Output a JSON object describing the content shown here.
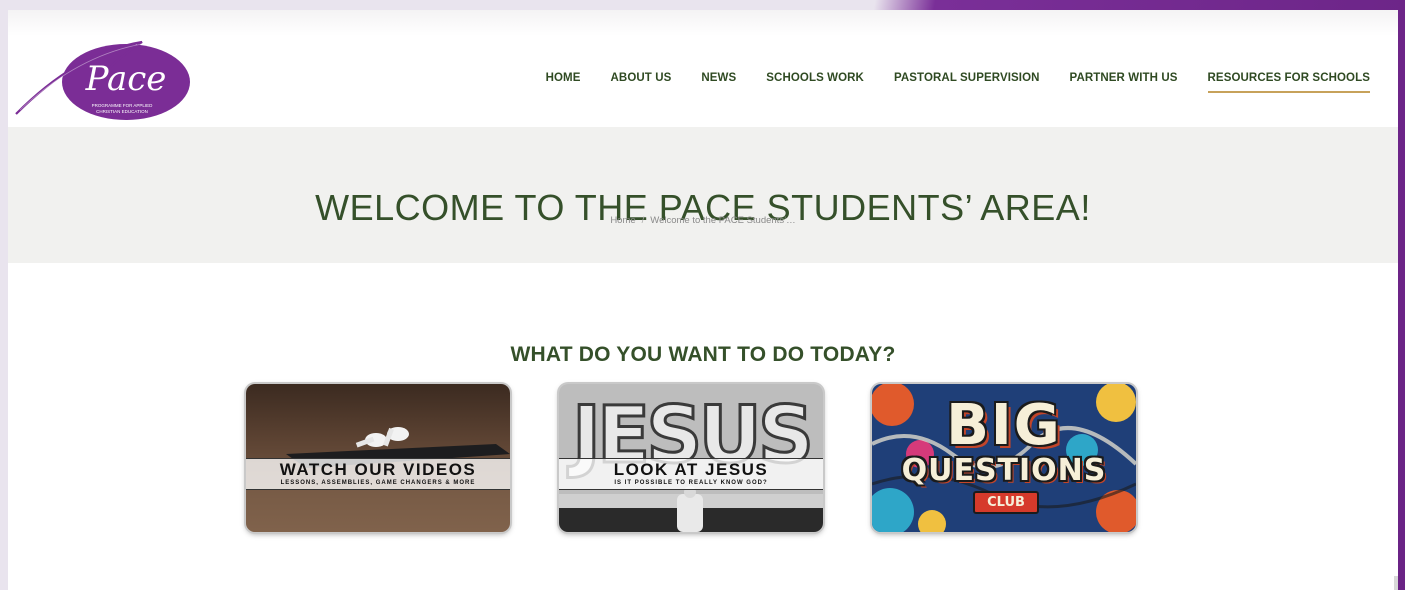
{
  "brand": {
    "logo_text": "Pace",
    "logo_subtitle_line1": "PROGRAMME FOR APPLIED",
    "logo_subtitle_line2": "CHRISTIAN EDUCATION",
    "logo_color": "#7b2d96"
  },
  "nav": {
    "items": [
      {
        "label": "HOME",
        "active": false
      },
      {
        "label": "ABOUT US",
        "active": false
      },
      {
        "label": "NEWS",
        "active": false
      },
      {
        "label": "SCHOOLS WORK",
        "active": false
      },
      {
        "label": "PASTORAL SUPERVISION",
        "active": false
      },
      {
        "label": "PARTNER WITH US",
        "active": false
      },
      {
        "label": "RESOURCES FOR SCHOOLS",
        "active": true
      }
    ],
    "active_underline_color": "#c7a25a"
  },
  "page": {
    "title": "WELCOME TO THE PACE STUDENTS’ AREA!",
    "breadcrumb": {
      "home": "Home",
      "separator": "/",
      "current": "Welcome to the PACE Students’…"
    }
  },
  "main": {
    "heading": "WHAT DO YOU WANT TO DO TODAY?",
    "cards": [
      {
        "title": "WATCH OUR VIDEOS",
        "subtitle": "LESSONS, ASSEMBLIES, GAME CHANGERS & MORE"
      },
      {
        "title": "LOOK AT JESUS",
        "subtitle": "IS IT POSSIBLE TO REALLY KNOW GOD?",
        "graffiti_text": "JESUS"
      },
      {
        "title_big": "BIG",
        "title_line2": "QUESTIONS",
        "badge": "CLUB"
      }
    ]
  },
  "colors": {
    "heading_green": "#35502a",
    "frame_purple": "#6b2a8a"
  }
}
